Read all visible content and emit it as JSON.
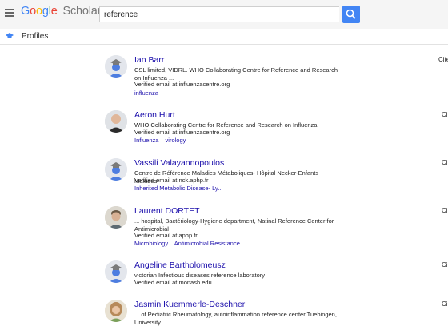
{
  "header": {
    "logo_google": "Google",
    "logo_scholar": "Scholar",
    "search_value": "reference"
  },
  "subheader": {
    "label": "Profiles"
  },
  "results": [
    {
      "name": "Ian Barr",
      "affiliation": "CSL limited, VIDRL. WHO Collaborating Centre for Reference and Research on Influenza ...",
      "email": "Verified email at influenzacentre.org",
      "interests": [
        "influenza"
      ],
      "cited": "Cite"
    },
    {
      "name": "Aeron Hurt",
      "affiliation": "WHO Collaborating Centre for Reference and Research on Influenza",
      "email": "Verified email at influenzacentre.org",
      "interests": [
        "Influenza",
        "virology"
      ],
      "cited": "Ci"
    },
    {
      "name": "Vassili Valayannopoulos",
      "affiliation": "Centre de Référence Maladies Métaboliques- Hôpital Necker-Enfants Malades",
      "email": "Verified email at nck.aphp.fr",
      "interests": [
        "Inherited Metabolic Disease- Ly..."
      ],
      "cited": "Ci"
    },
    {
      "name": "Laurent DORTET",
      "affiliation": "... hospital, Bactériology-Hygiene department, Natinal Reference Center for Antimicrobial",
      "email": "Verified email at aphp.fr",
      "interests": [
        "Microbiology",
        "Antimicrobial Resistance"
      ],
      "cited": "Ci"
    },
    {
      "name": "Angeline Bartholomeusz",
      "affiliation": "victorian Infectious diseases reference laboratory",
      "email": "Verified email at monash.edu",
      "interests": [],
      "cited": "Ci"
    },
    {
      "name": "Jasmin Kuemmerle-Deschner",
      "affiliation": "... of Pediatric Rheumatology, autoinflammation reference center Tuebingen, University",
      "email": "",
      "interests": [],
      "cited": "Ci"
    }
  ],
  "colors": {
    "link": "#1a0dab",
    "search_button": "#4285f4",
    "header_bg": "#f5f5f5"
  },
  "icons": {
    "menu": "hamburger-menu-icon",
    "search": "search-icon",
    "profiles": "graduation-cap-icon",
    "avatar_default": "default-avatar-icon"
  }
}
